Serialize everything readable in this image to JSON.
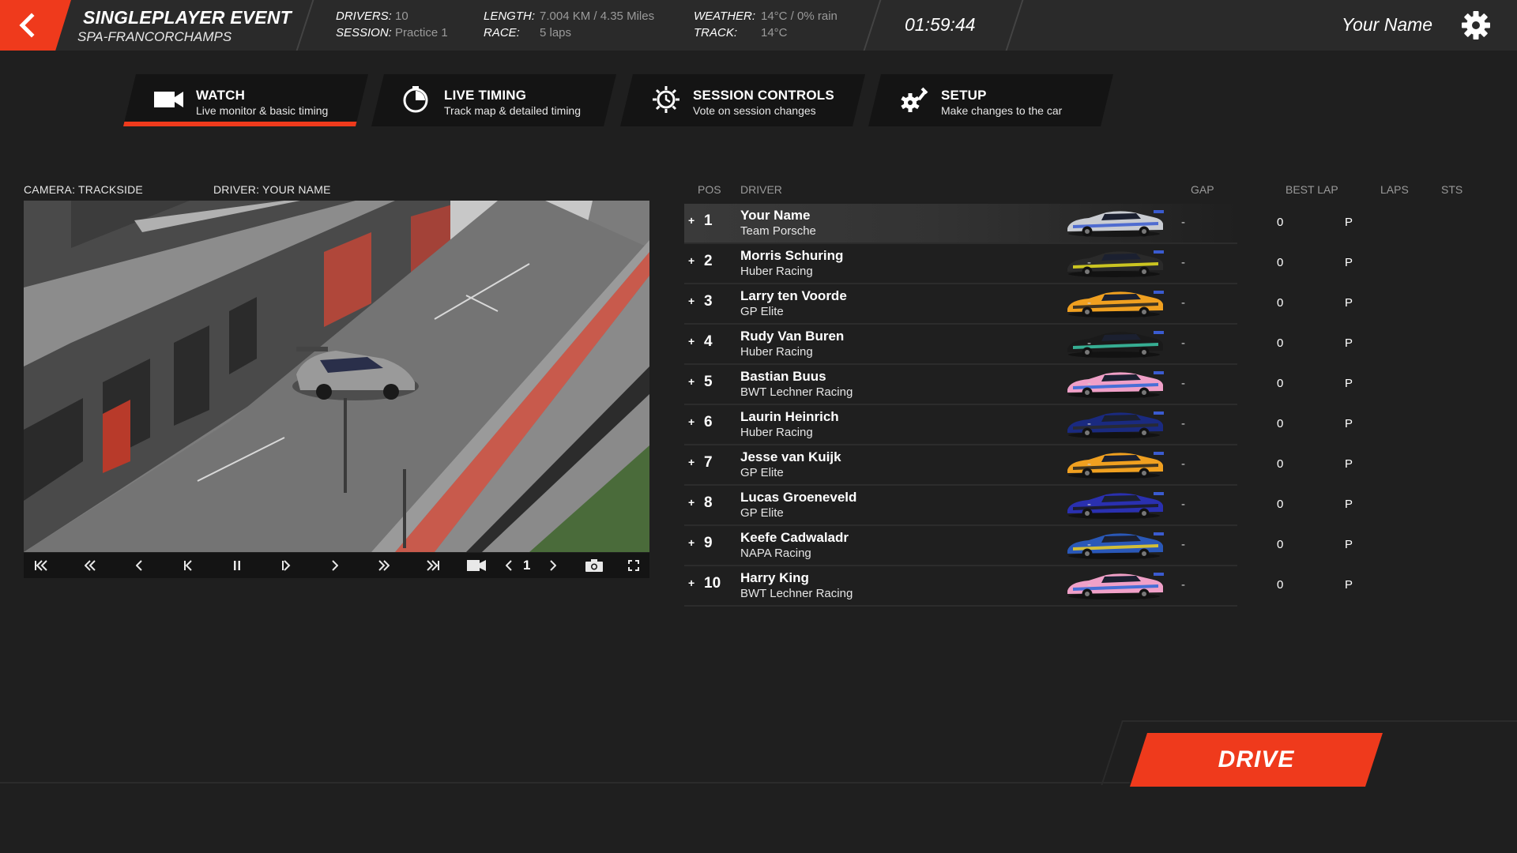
{
  "header": {
    "title": "SINGLEPLAYER EVENT",
    "track": "SPA-FRANCORCHAMPS",
    "drivers_label": "DRIVERS:",
    "drivers_value": "10",
    "session_label": "SESSION:",
    "session_value": "Practice 1",
    "length_label": "LENGTH:",
    "length_value": "7.004 KM / 4.35 Miles",
    "race_label": "RACE:",
    "race_value": "5 laps",
    "weather_label": "WEATHER:",
    "weather_value": "14°C / 0% rain",
    "track_label": "TRACK:",
    "track_value": "14°C",
    "clock": "01:59:44",
    "username": "Your Name"
  },
  "tabs": [
    {
      "title": "WATCH",
      "subtitle": "Live monitor & basic timing",
      "icon": "video-camera-icon",
      "active": true
    },
    {
      "title": "LIVE TIMING",
      "subtitle": "Track map & detailed timing",
      "icon": "stopwatch-icon",
      "active": false
    },
    {
      "title": "SESSION CONTROLS",
      "subtitle": "Vote on session changes",
      "icon": "gear-clock-icon",
      "active": false
    },
    {
      "title": "SETUP",
      "subtitle": "Make changes to the car",
      "icon": "gear-wrench-icon",
      "active": false
    }
  ],
  "viewer": {
    "camera_label": "CAMERA: TRACKSIDE",
    "driver_label": "DRIVER: YOUR NAME",
    "camera_number": "1"
  },
  "table": {
    "headers": {
      "pos": "POS",
      "driver": "DRIVER",
      "gap": "GAP",
      "best_lap": "BEST LAP",
      "laps": "LAPS",
      "sts": "STS"
    },
    "rows": [
      {
        "pos": "1",
        "name": "Your Name",
        "team": "Team Porsche",
        "gap": "-",
        "best": "-",
        "laps": "0",
        "sts": "P",
        "livery": "#c9ccd2",
        "accent": "#3a5bd0"
      },
      {
        "pos": "2",
        "name": "Morris Schuring",
        "team": "Huber Racing",
        "gap": "-",
        "best": "-",
        "laps": "0",
        "sts": "P",
        "livery": "#2a2a2a",
        "accent": "#e8e020"
      },
      {
        "pos": "3",
        "name": "Larry ten Voorde",
        "team": "GP Elite",
        "gap": "-",
        "best": "-",
        "laps": "0",
        "sts": "P",
        "livery": "#f0a020",
        "accent": "#222222"
      },
      {
        "pos": "4",
        "name": "Rudy Van Buren",
        "team": "Huber Racing",
        "gap": "-",
        "best": "-",
        "laps": "0",
        "sts": "P",
        "livery": "#1a1a1a",
        "accent": "#3cc8a8"
      },
      {
        "pos": "5",
        "name": "Bastian Buus",
        "team": "BWT Lechner Racing",
        "gap": "-",
        "best": "-",
        "laps": "0",
        "sts": "P",
        "livery": "#f0a0c8",
        "accent": "#2a66d8"
      },
      {
        "pos": "6",
        "name": "Laurin Heinrich",
        "team": "Huber Racing",
        "gap": "-",
        "best": "-",
        "laps": "0",
        "sts": "P",
        "livery": "#1a2a80",
        "accent": "#2a2a2a"
      },
      {
        "pos": "7",
        "name": "Jesse van Kuijk",
        "team": "GP Elite",
        "gap": "-",
        "best": "-",
        "laps": "0",
        "sts": "P",
        "livery": "#f0a020",
        "accent": "#222222"
      },
      {
        "pos": "8",
        "name": "Lucas Groeneveld",
        "team": "GP Elite",
        "gap": "-",
        "best": "-",
        "laps": "0",
        "sts": "P",
        "livery": "#2a30b0",
        "accent": "#1a1a1a"
      },
      {
        "pos": "9",
        "name": "Keefe Cadwaladr",
        "team": "NAPA Racing",
        "gap": "-",
        "best": "-",
        "laps": "0",
        "sts": "P",
        "livery": "#2a58b8",
        "accent": "#f0d020"
      },
      {
        "pos": "10",
        "name": "Harry King",
        "team": "BWT Lechner Racing",
        "gap": "-",
        "best": "-",
        "laps": "0",
        "sts": "P",
        "livery": "#f0a0c8",
        "accent": "#2a66d8"
      }
    ]
  },
  "drive_label": "DRIVE",
  "colors": {
    "accent": "#ef3a1c",
    "bg": "#1f1f1f",
    "bar": "#2a2a2a"
  }
}
